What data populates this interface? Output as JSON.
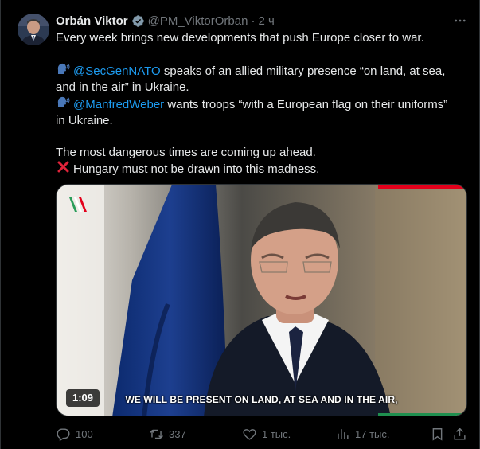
{
  "tweet": {
    "author_name": "Orbán Viktor",
    "handle": "@PM_ViktorOrban",
    "separator": "·",
    "time": "2 ч",
    "lines": [
      "Every week brings new developments that push Europe closer to war."
    ],
    "para2": {
      "mention1": "@SecGenNATO",
      "text1a": " speaks of an allied military presence “on land, at sea,",
      "text1b": "and in the air” in Ukraine.",
      "mention2": "@ManfredWeber",
      "text2a": " wants troops “with a European flag on their uniforms”",
      "text2b": "in Ukraine."
    },
    "para3": {
      "line1": "The most dangerous times are coming up ahead.",
      "line2": "Hungary must not be drawn into this madness."
    },
    "icons": {
      "speaking": "speaking-head-emoji",
      "cross": "cross-mark-emoji",
      "verified": "verified-badge-icon",
      "more": "more-icon"
    }
  },
  "video": {
    "duration": "1:09",
    "subtitle": "WE WILL BE PRESENT ON LAND, AT SEA AND IN THE AIR,"
  },
  "actions": {
    "replies": "100",
    "reposts": "337",
    "likes": "1 тыс.",
    "views": "17 тыс."
  },
  "colors": {
    "background": "#000000",
    "text": "#e7e9ea",
    "secondary": "#71767b",
    "link": "#1d9bf0",
    "verified": "#829aab"
  }
}
